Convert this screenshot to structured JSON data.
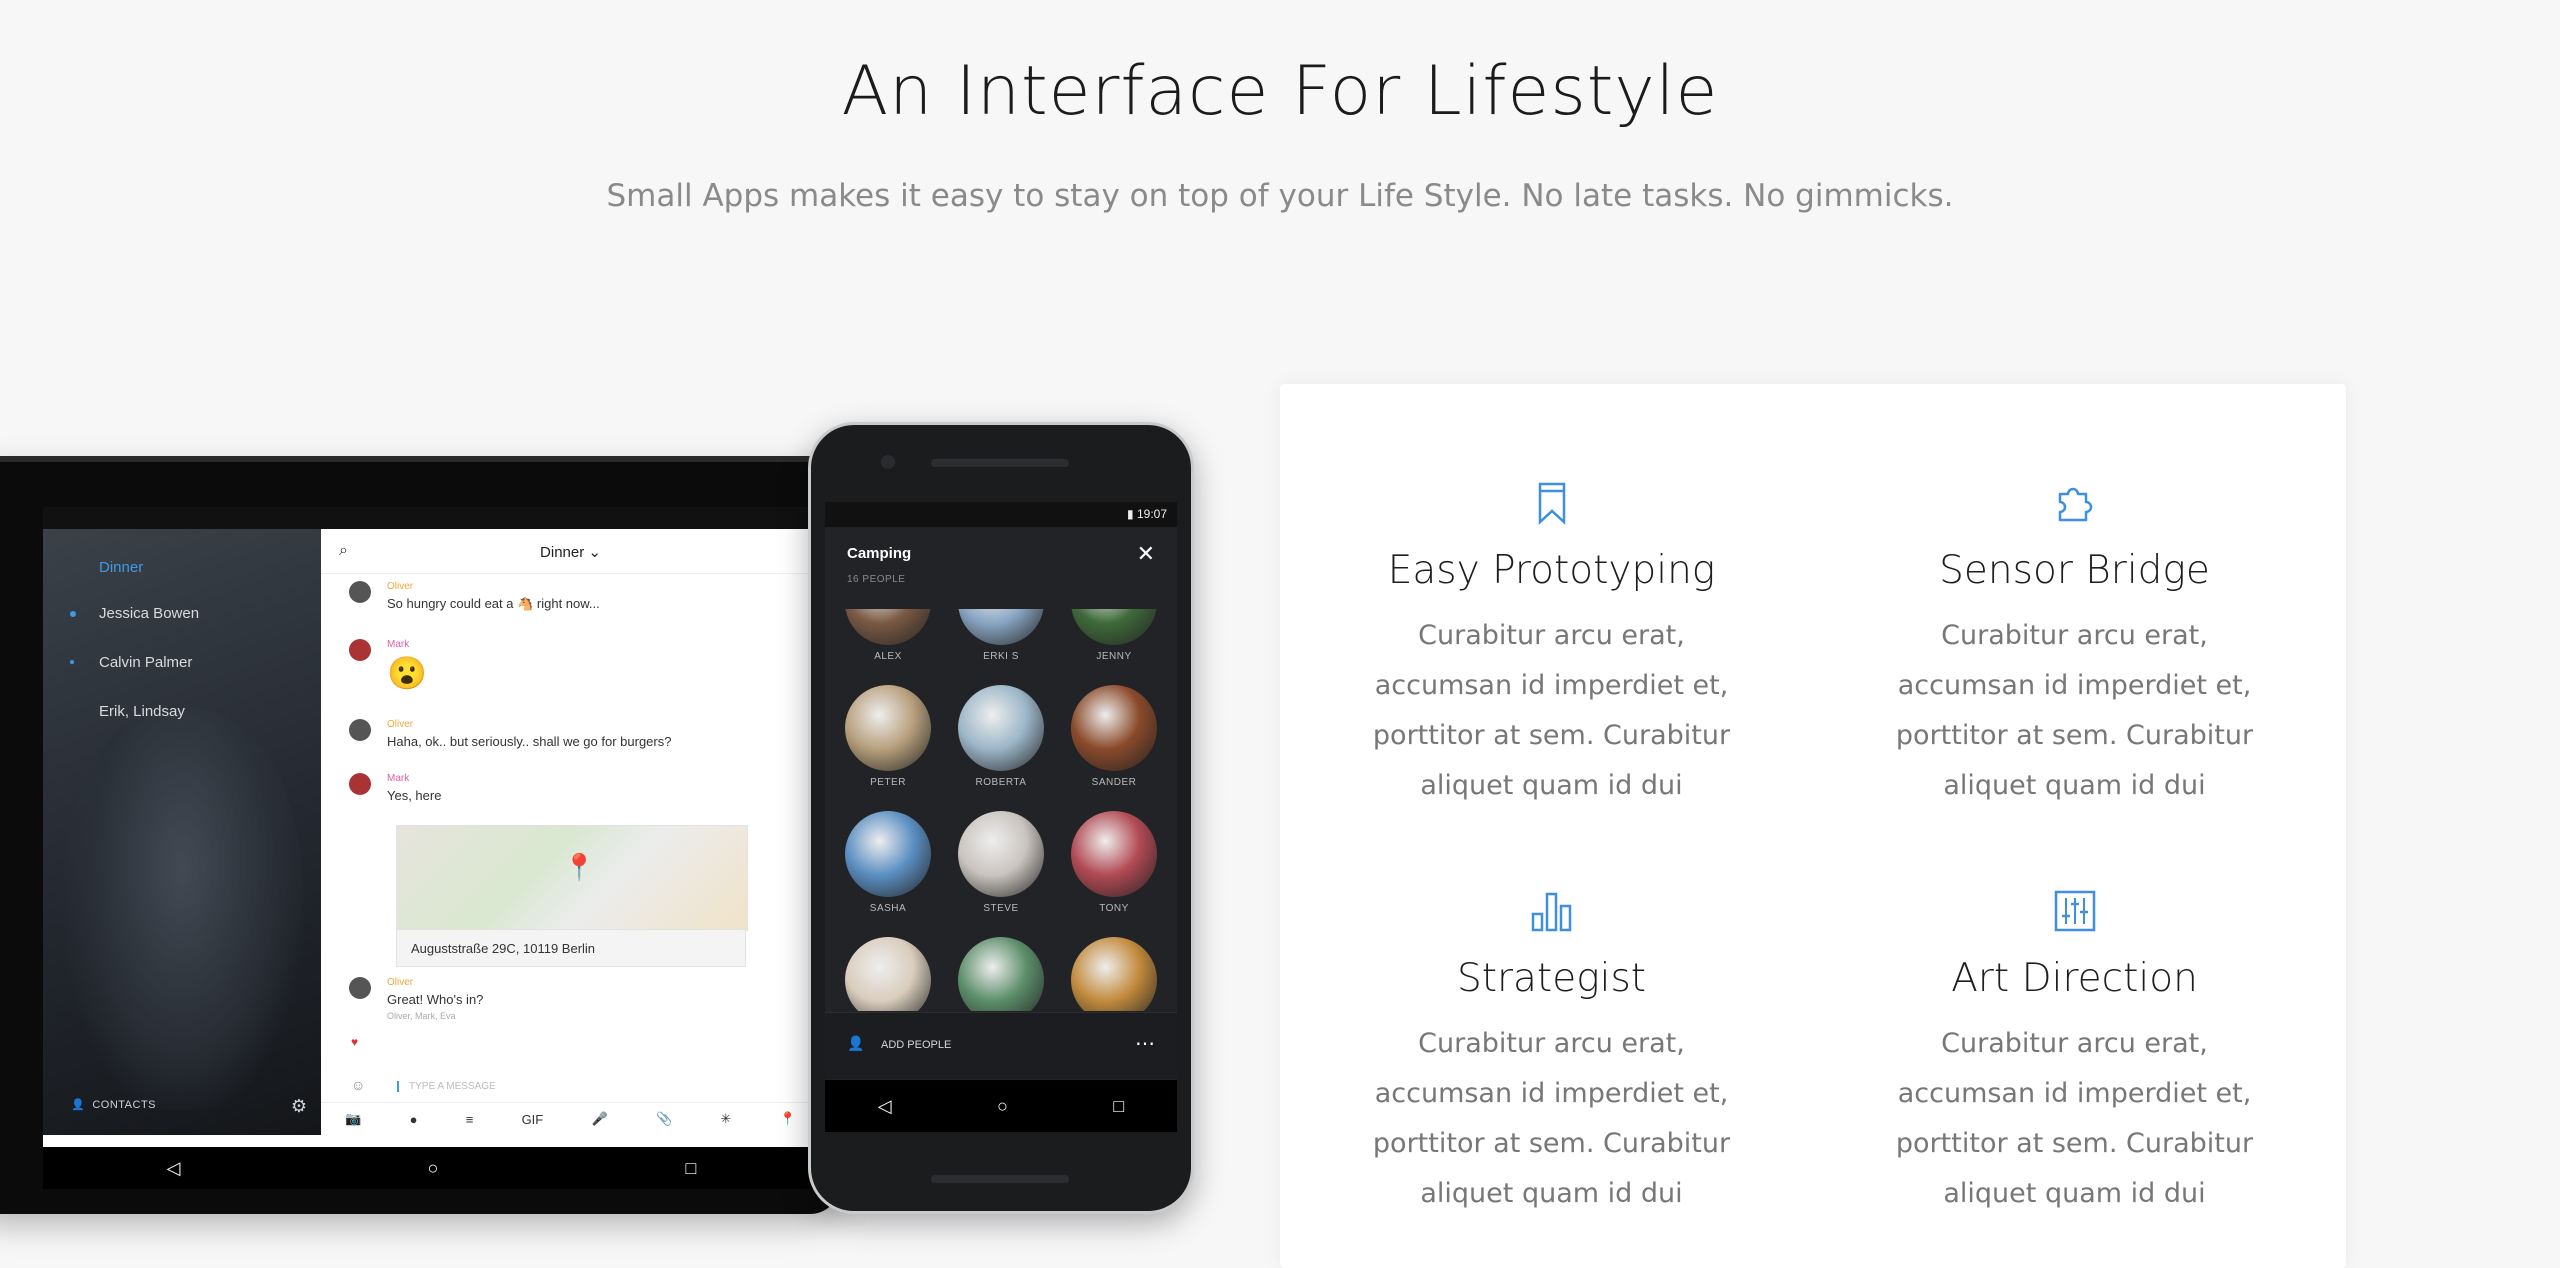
{
  "hero": {
    "title": "An Interface For Lifestyle",
    "subtitle": "Small Apps makes it easy to stay on top of your Life Style. No late tasks. No gimmicks."
  },
  "tablet": {
    "sidebar": {
      "items": [
        "Dinner",
        "Jessica Bowen",
        "Calvin Palmer",
        "Erik, Lindsay"
      ],
      "contacts_label": "CONTACTS"
    },
    "chat": {
      "title": "Dinner",
      "messages": [
        {
          "sender": "Oliver",
          "text": "So hungry could eat a 🐴 right now..."
        },
        {
          "sender": "Mark",
          "text": "😮"
        },
        {
          "sender": "Oliver",
          "text": "Haha, ok.. but seriously.. shall we go for burgers?"
        },
        {
          "sender": "Mark",
          "text": "Yes, here"
        },
        {
          "sender": "Oliver",
          "text": "Great! Who's in?",
          "meta": "Oliver, Mark, Eva"
        }
      ],
      "map_caption": "Auguststraße 29C, 10119 Berlin",
      "input_placeholder": "TYPE A MESSAGE",
      "toolbar": [
        "📷",
        "●",
        "≡",
        "GIF",
        "🎤",
        "📎",
        "✳",
        "📍"
      ]
    },
    "nav": [
      "◁",
      "○",
      "□"
    ]
  },
  "phone": {
    "time": "19:07",
    "title": "Camping",
    "count": "16 PEOPLE",
    "people": [
      {
        "name": "ALEX",
        "color": "#7a5a44"
      },
      {
        "name": "ERKI S",
        "color": "#8aa6c4"
      },
      {
        "name": "JENNY",
        "color": "#3f6a3a"
      },
      {
        "name": "PETER",
        "color": "#b8a07d"
      },
      {
        "name": "ROBERTA",
        "color": "#9cb6c8"
      },
      {
        "name": "SANDER",
        "color": "#8a4a2a"
      },
      {
        "name": "SASHA",
        "color": "#5b8fc2"
      },
      {
        "name": "STEVE",
        "color": "#c9c4bf"
      },
      {
        "name": "TONY",
        "color": "#b24a54"
      },
      {
        "name": "",
        "color": "#d9cdbd"
      },
      {
        "name": "",
        "color": "#5c8e6a"
      },
      {
        "name": "",
        "color": "#c28a3c"
      }
    ],
    "add_label": "ADD PEOPLE",
    "nav": [
      "◁",
      "○",
      "□"
    ]
  },
  "features": [
    {
      "icon": "bookmark-icon",
      "title": "Easy Prototyping",
      "desc": "Curabitur arcu erat, accumsan id imperdiet et, porttitor at sem. Curabitur aliquet quam id dui"
    },
    {
      "icon": "puzzle-icon",
      "title": "Sensor Bridge",
      "desc": "Curabitur arcu erat, accumsan id imperdiet et, porttitor at sem. Curabitur aliquet quam id dui"
    },
    {
      "icon": "bar-chart-icon",
      "title": "Strategist",
      "desc": "Curabitur arcu erat, accumsan id imperdiet et, porttitor at sem. Curabitur aliquet quam id dui"
    },
    {
      "icon": "sliders-icon",
      "title": "Art Direction",
      "desc": "Curabitur arcu erat, accumsan id imperdiet et, porttitor at sem. Curabitur aliquet quam id dui"
    }
  ],
  "colors": {
    "accent": "#3e8fe0",
    "title": "#1b1b1b",
    "muted": "#8a8a8a"
  }
}
